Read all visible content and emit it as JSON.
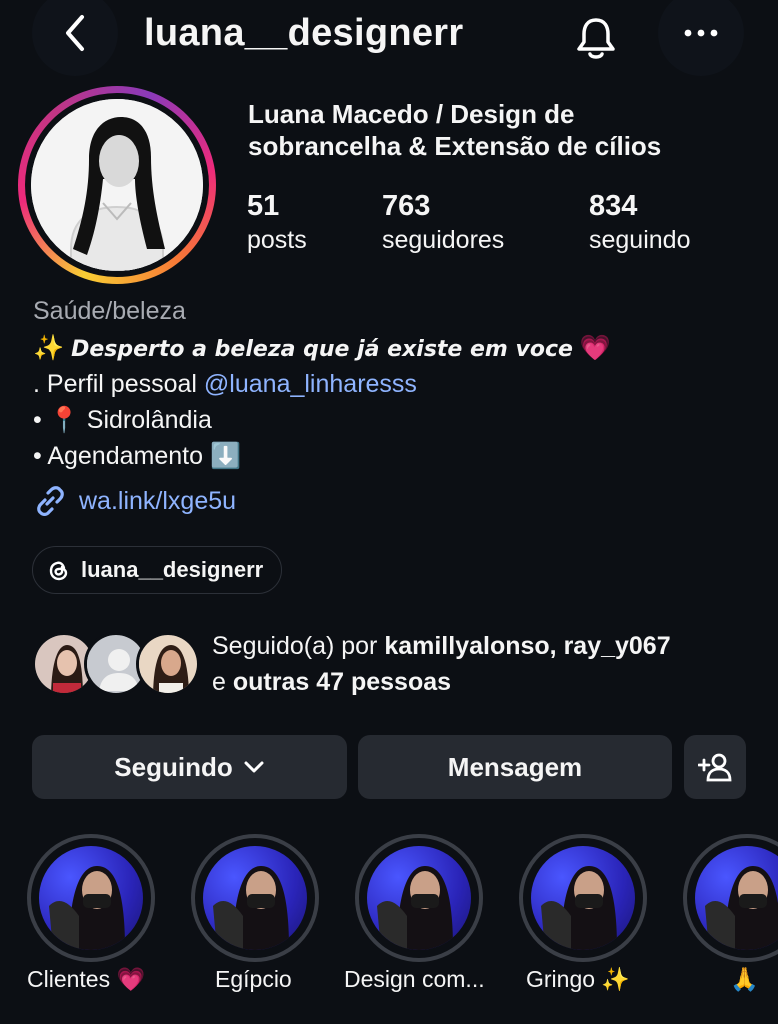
{
  "header": {
    "username": "luana__designerr",
    "back_icon": "chevron-left-icon",
    "bell_icon": "bell-icon",
    "more_icon": "more-horizontal-icon"
  },
  "profile": {
    "display_name_line1": "Luana Macedo / Design de",
    "display_name_line2": "sobrancelha & Extensão de cílios",
    "stats": [
      {
        "num": "51",
        "label": "posts"
      },
      {
        "num": "763",
        "label": "seguidores"
      },
      {
        "num": "834",
        "label": "seguindo"
      }
    ],
    "category": "Saúde/beleza",
    "bio": {
      "tagline_prefix": "✨",
      "tagline": "Desperto a beleza que já existe em voce",
      "tagline_suffix": "💗",
      "line2_text": ". Perfil pessoal ",
      "line2_mention": "@luana_linharesss",
      "line3": "• 📍 Sidrolândia",
      "line4": "• Agendamento ⬇️"
    },
    "link": "wa.link/lxge5u",
    "threads_handle": "luana__designerr"
  },
  "followed_by": {
    "prefix": "Seguido(a) por ",
    "names": "kamillyalonso, ray_y067",
    "line2_prefix": "e ",
    "others": "outras 47 pessoas"
  },
  "actions": {
    "following_label": "Seguindo",
    "message_label": "Mensagem"
  },
  "highlights": [
    {
      "label": "Clientes 💗"
    },
    {
      "label": "Egípcio"
    },
    {
      "label": "Design com..."
    },
    {
      "label": "Gringo ✨"
    },
    {
      "label": "🙏"
    }
  ],
  "colors": {
    "background": "#0c0f14",
    "button": "#262a31",
    "link": "#8fb4ff",
    "muted": "#a8abb2"
  }
}
